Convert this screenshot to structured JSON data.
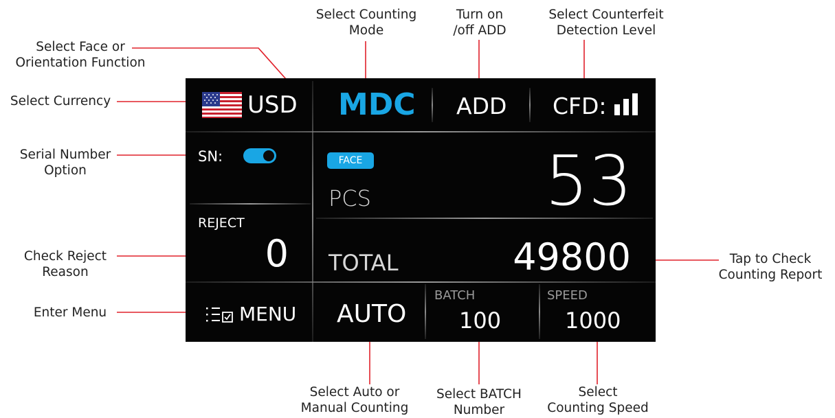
{
  "screen": {
    "currency": "USD",
    "counting_mode": "MDC",
    "add_label": "ADD",
    "cfd_label": "CFD:",
    "sn_label": "SN:",
    "sn_enabled": true,
    "face_badge": "FACE",
    "pcs_label": "PCS",
    "pcs_value": "53",
    "reject_label": "REJECT",
    "reject_value": "0",
    "total_label": "TOTAL",
    "total_value": "49800",
    "menu_label": "MENU",
    "auto_label": "AUTO",
    "batch_label": "BATCH",
    "batch_value": "100",
    "speed_label": "SPEED",
    "speed_value": "1000",
    "cfd_level_bars": 3,
    "icons": [
      "us-flag-icon",
      "signal-bars-icon",
      "toggle-switch-icon",
      "menu-checklist-icon"
    ],
    "colors": {
      "accent": "#19a6e4",
      "background": "#050505",
      "text": "#ffffff",
      "callout": "#e0202a"
    }
  },
  "callouts": {
    "select_counting_mode": "Select Counting\nMode",
    "turn_on_off_add": "Turn on\n/off ADD",
    "select_cfd_level": "Select Counterfeit\nDetection Level",
    "select_face": "Select Face or\nOrientation Function",
    "select_currency": "Select Currency",
    "serial_number": "Serial Number\nOption",
    "check_reject": "Check Reject\nReason",
    "enter_menu": "Enter Menu",
    "check_report": "Tap to Check\nCounting  Report",
    "select_auto": "Select Auto or\nManual Counting",
    "select_batch": "Select BATCH\nNumber",
    "select_speed": "Select\nCounting Speed"
  }
}
